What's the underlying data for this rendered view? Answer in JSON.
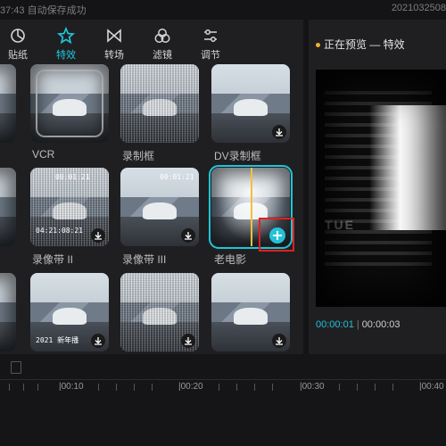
{
  "topbar": {
    "left_text": "37:43 自动保存成功",
    "right_text": "2021032508"
  },
  "tabs": [
    {
      "label": "贴纸",
      "icon": "sticker-icon"
    },
    {
      "label": "特效",
      "icon": "effects-star-icon",
      "active": true
    },
    {
      "label": "转场",
      "icon": "transition-icon"
    },
    {
      "label": "滤镜",
      "icon": "filter-icon"
    },
    {
      "label": "调节",
      "icon": "adjust-sliders-icon"
    }
  ],
  "effects": {
    "row1": [
      "VCR",
      "录制框",
      "DV录制框"
    ],
    "row2": [
      "录像带 II",
      "录像带 III",
      "老电影"
    ],
    "stamps": {
      "row2_left_top": "00:01:21",
      "row2_left_bottom": "04:21:08:21",
      "row2_mid_top": "00:01:21",
      "row3_left": "2021 新年播"
    }
  },
  "preview": {
    "title": "正在预览 — 特效",
    "current_time": "00:00:01",
    "separator": "|",
    "total_time": "00:00:03",
    "watermark": "TUE"
  },
  "timeline": {
    "ticks": [
      "|00:10",
      "|00:20",
      "|00:30",
      "|00:40"
    ]
  },
  "colors": {
    "accent": "#22c3d8",
    "highlight": "#e02020",
    "playhead": "#f0c040"
  }
}
